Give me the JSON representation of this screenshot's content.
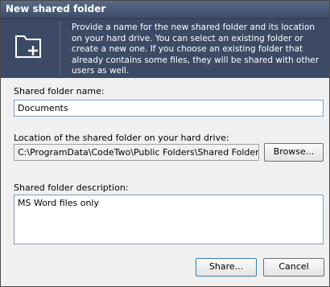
{
  "window": {
    "title": "New shared folder"
  },
  "banner": {
    "icon": "folder-add-icon",
    "description": "Provide a name for the new shared folder and its location on your hard drive. You can select an existing folder or create a new one. If you choose an existing folder that already contains some files, they will be shared with other users as well."
  },
  "form": {
    "name_label": "Shared folder name:",
    "name_value": "Documents",
    "location_label": "Location of the shared folder on your hard drive:",
    "location_value": "C:\\ProgramData\\CodeTwo\\Public Folders\\Shared Folders\\Doc",
    "browse_label": "Browse...",
    "description_label": "Shared folder description:",
    "description_value": "MS Word files only"
  },
  "footer": {
    "share_label": "Share...",
    "cancel_label": "Cancel"
  },
  "colors": {
    "banner": "#3d4a66",
    "titlebar": "#3d4b66"
  }
}
